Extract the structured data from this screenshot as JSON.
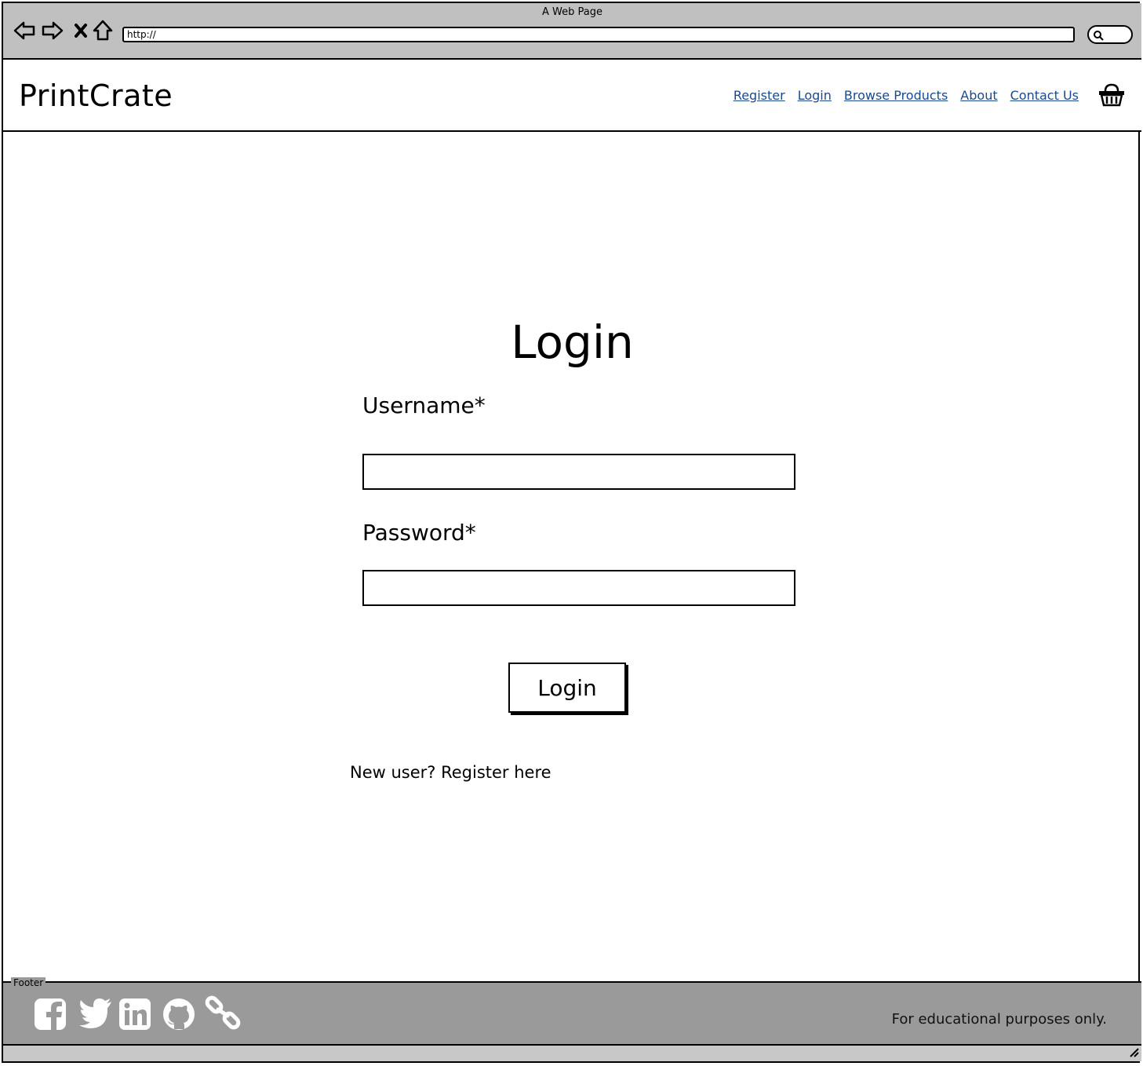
{
  "browser": {
    "window_title": "A Web Page",
    "url": "http://",
    "icons": {
      "back": "back-arrow-icon",
      "forward": "forward-arrow-icon",
      "stop": "close-icon",
      "home": "home-icon",
      "search": "search-icon"
    }
  },
  "header": {
    "brand": "PrintCrate",
    "nav": {
      "register": "Register",
      "login": "Login",
      "browse_products": "Browse Products",
      "about": "About",
      "contact_us": "Contact Us"
    },
    "cart_icon": "basket-icon",
    "link_color": "#1a4a8c"
  },
  "main": {
    "title": "Login",
    "username_label": "Username*",
    "username_value": "",
    "password_label": "Password*",
    "password_value": "",
    "submit_label": "Login",
    "register_prompt": "New user? Register here"
  },
  "footer": {
    "label": "Footer",
    "social_icons": [
      "facebook-icon",
      "twitter-icon",
      "linkedin-icon",
      "github-icon",
      "link-icon"
    ],
    "note": "For educational purposes only.",
    "background": "#9a9a9a"
  }
}
